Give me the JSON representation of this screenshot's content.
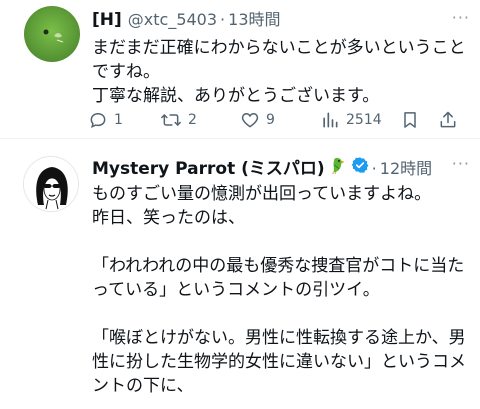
{
  "tweet1": {
    "name": "[H]",
    "handle": "@xtc_5403",
    "separator": "·",
    "time": "13時間",
    "more": "···",
    "text": "まだまだ正確にわからないことが多いということですね。\n丁寧な解説、ありがとうございます。",
    "actions": {
      "replies": "1",
      "reposts": "2",
      "likes": "9",
      "views": "2514"
    }
  },
  "tweet2": {
    "name": "Mystery Parrot (ミスパロ)",
    "separator": "·",
    "time": "12時間",
    "more": "···",
    "text": "ものすごい量の憶測が出回っていますよね。\n昨日、笑ったのは、\n\n「われわれの中の最も優秀な捜査官がコトに当たっている」というコメントの引ツイ。\n\n「喉ぼとけがない。男性に性転換する途上か、男性に扮した生物学的女性に違いない」というコメントの下に、"
  },
  "icons": {
    "reply": "reply-icon",
    "repost": "repost-icon",
    "like": "like-icon",
    "views": "views-icon",
    "bookmark": "bookmark-icon",
    "share": "share-icon",
    "verified": "verified-badge-icon",
    "parrot": "parrot-emoji-icon"
  },
  "colors": {
    "verified": "#1d9bf0",
    "muted": "#536471",
    "text": "#0f1419"
  }
}
